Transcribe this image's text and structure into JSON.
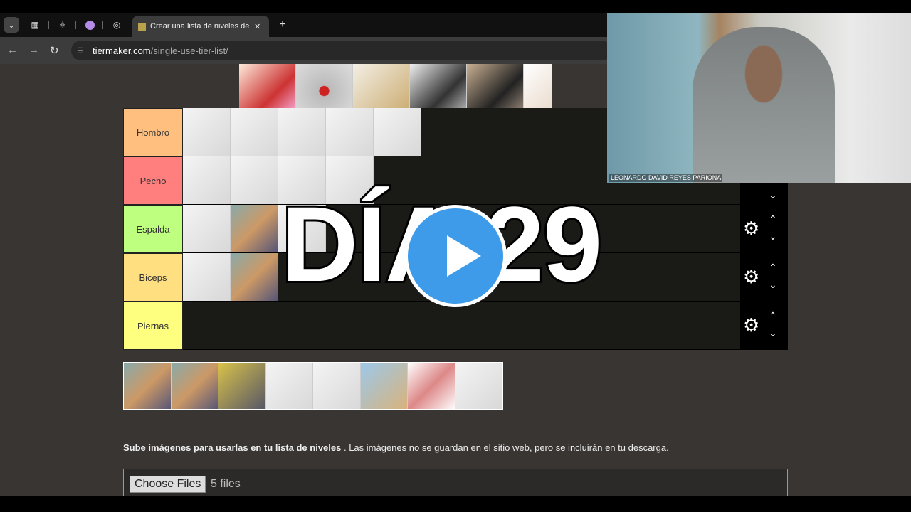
{
  "browser": {
    "active_tab_title": "Crear una lista de niveles de un",
    "url_domain": "tiermaker.com",
    "url_path": "/single-use-tier-list/"
  },
  "tiers": [
    {
      "label": "Hombro",
      "color": "#ffbf7f",
      "image_count": 5
    },
    {
      "label": "Pecho",
      "color": "#ff7f7f",
      "image_count": 4
    },
    {
      "label": "Espalda",
      "color": "#bfff7f",
      "image_count": 3
    },
    {
      "label": "Biceps",
      "color": "#ffdf7f",
      "image_count": 2
    },
    {
      "label": "Piernas",
      "color": "#ffff7f",
      "image_count": 0
    }
  ],
  "upload": {
    "message_bold": "Sube imágenes para usarlas en tu lista de niveles",
    "message_rest": " . Las imágenes no se guardan en el sitio web, pero se incluirán en tu descarga.",
    "choose_label": "Choose Files",
    "file_status": "5 files"
  },
  "webcam": {
    "name": "LEONARDO DAVID REYES PARIONA"
  },
  "overlay": {
    "title": "DÍA 29",
    "accent": "#3d9be9"
  }
}
